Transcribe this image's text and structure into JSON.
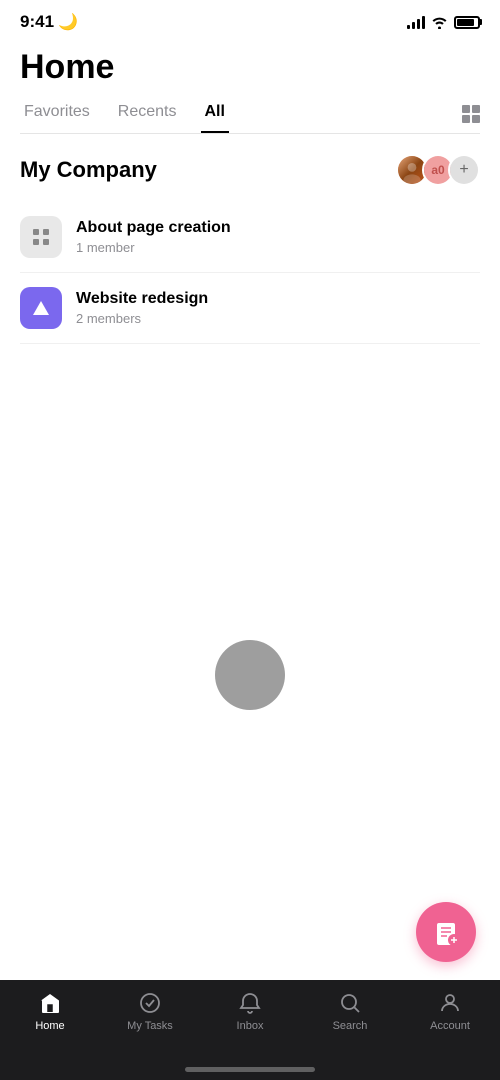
{
  "statusBar": {
    "time": "9:41",
    "moonIcon": "🌙"
  },
  "header": {
    "title": "Home"
  },
  "tabs": [
    {
      "label": "Favorites",
      "active": false
    },
    {
      "label": "Recents",
      "active": false
    },
    {
      "label": "All",
      "active": true
    }
  ],
  "company": {
    "name": "My Company",
    "avatars": [
      {
        "type": "image",
        "initials": ""
      },
      {
        "type": "initials",
        "text": "a0"
      },
      {
        "type": "add",
        "text": "+"
      }
    ]
  },
  "projects": [
    {
      "name": "About page creation",
      "members": "1 member",
      "iconType": "grey",
      "iconSymbol": "▦"
    },
    {
      "name": "Website redesign",
      "members": "2 members",
      "iconType": "purple",
      "iconSymbol": "▲"
    }
  ],
  "bottomNav": [
    {
      "label": "Home",
      "icon": "home",
      "active": true
    },
    {
      "label": "My Tasks",
      "icon": "check-circle",
      "active": false
    },
    {
      "label": "Inbox",
      "icon": "bell",
      "active": false
    },
    {
      "label": "Search",
      "icon": "search",
      "active": false
    },
    {
      "label": "Account",
      "icon": "person",
      "active": false
    }
  ],
  "fab": {
    "icon": "📋",
    "label": "new task"
  }
}
